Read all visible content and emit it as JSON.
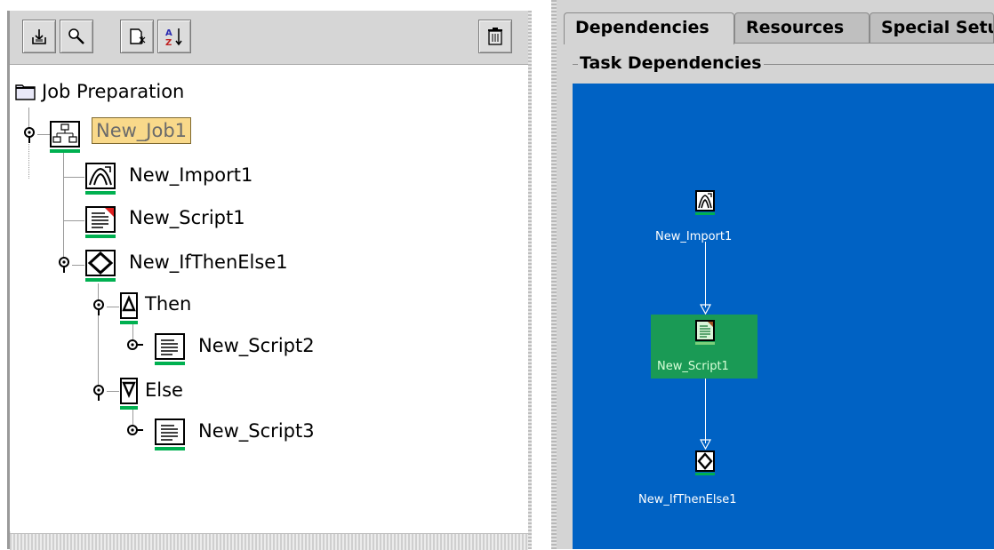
{
  "toolbar": {
    "buttons": [
      {
        "icon": "import-icon"
      },
      {
        "icon": "search-icon"
      },
      {
        "icon": "new-document-icon"
      },
      {
        "icon": "sort-az-icon"
      }
    ],
    "delete_icon": "trash-icon"
  },
  "tree": {
    "root_label": "Job Preparation",
    "job_label": "New_Job1",
    "import_label": "New_Import1",
    "script1_label": "New_Script1",
    "ifthenelse_label": "New_IfThenElse1",
    "then_label": "Then",
    "script2_label": "New_Script2",
    "else_label": "Else",
    "script3_label": "New_Script3"
  },
  "tabs": [
    {
      "label": "Dependencies",
      "active": true
    },
    {
      "label": "Resources",
      "active": false
    },
    {
      "label": "Special Setu",
      "active": false
    }
  ],
  "group_title": "Task Dependencies",
  "graph": {
    "nodes": [
      {
        "label": "New_Import1",
        "icon": "import-icon"
      },
      {
        "label": "New_Script1",
        "icon": "script-icon",
        "selected": true
      },
      {
        "label": "New_IfThenElse1",
        "icon": "ifthenelse-icon"
      }
    ]
  },
  "colors": {
    "canvas": "#0062c4",
    "selected_node": "#1a9a55",
    "tree_selection": "#f9d98a",
    "status_bar": "#00b050"
  }
}
